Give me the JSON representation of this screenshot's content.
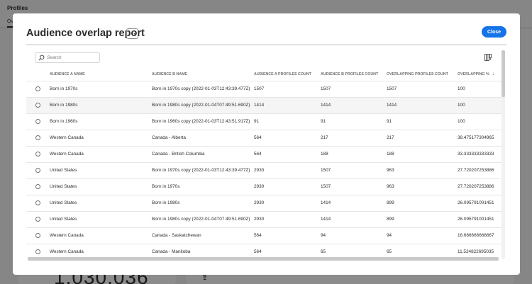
{
  "background": {
    "page_title": "Profiles",
    "tab_label": "Ove",
    "big_number": "1,030,036",
    "vertical_label": "rofile"
  },
  "dialog": {
    "title": "Audience overlap report",
    "more_label": "···",
    "close_label": "Close",
    "search": {
      "placeholder": "Search",
      "value": ""
    },
    "columns": {
      "audience_a": "AUDIENCE A NAME",
      "audience_b": "AUDIENCE B NAME",
      "count_a": "AUDIENCE A PROFILES COUNT",
      "count_b": "AUDIENCE B PROFILES COUNT",
      "overlap": "OVERLAPPING PROFILES COUNT",
      "pct": "OVERLAPPING %",
      "pct_sort": "↓"
    },
    "rows": [
      {
        "a": "Born in 1970s",
        "b": "Born in 1970s copy (2022-01-03T12:43:39.477Z)",
        "ca": "1507",
        "cb": "1507",
        "ov": "1507",
        "pct": "100"
      },
      {
        "a": "Born in 1980s",
        "b": "Born in 1980s copy (2022-01-04T07:49:51.690Z)",
        "ca": "1414",
        "cb": "1414",
        "ov": "1414",
        "pct": "100"
      },
      {
        "a": "Born in 1960s",
        "b": "Born in 1960s copy (2022-01-03T12:43:51.917Z)",
        "ca": "91",
        "cb": "91",
        "ov": "91",
        "pct": "100"
      },
      {
        "a": "Western Canada",
        "b": "Canada - Alberta",
        "ca": "564",
        "cb": "217",
        "ov": "217",
        "pct": "38.475177304965"
      },
      {
        "a": "Western Canada",
        "b": "Canada - British Columbia",
        "ca": "564",
        "cb": "188",
        "ov": "188",
        "pct": "33.333333333333"
      },
      {
        "a": "United States",
        "b": "Born in 1970s copy (2022-01-03T12:43:39.477Z)",
        "ca": "2930",
        "cb": "1507",
        "ov": "963",
        "pct": "27.720207253886"
      },
      {
        "a": "United States",
        "b": "Born in 1970s",
        "ca": "2930",
        "cb": "1507",
        "ov": "963",
        "pct": "27.720207253886"
      },
      {
        "a": "United States",
        "b": "Born in 1980s",
        "ca": "2930",
        "cb": "1414",
        "ov": "899",
        "pct": "26.095791001451"
      },
      {
        "a": "United States",
        "b": "Born in 1980s copy (2022-01-04T07:49:51.690Z)",
        "ca": "2930",
        "cb": "1414",
        "ov": "899",
        "pct": "26.095791001451"
      },
      {
        "a": "Western Canada",
        "b": "Canada - Saskatchewan",
        "ca": "564",
        "cb": "94",
        "ov": "94",
        "pct": "16.666666666667"
      },
      {
        "a": "Western Canada",
        "b": "Canada - Manitoba",
        "ca": "564",
        "cb": "65",
        "ov": "65",
        "pct": "11.524822695035"
      }
    ]
  },
  "colors": {
    "accent": "#1473e6",
    "overlay": "rgba(0,0,0,0.45)"
  },
  "icons": {
    "search": "search-icon",
    "column_settings": "column-settings-icon",
    "more": "more-icon"
  }
}
